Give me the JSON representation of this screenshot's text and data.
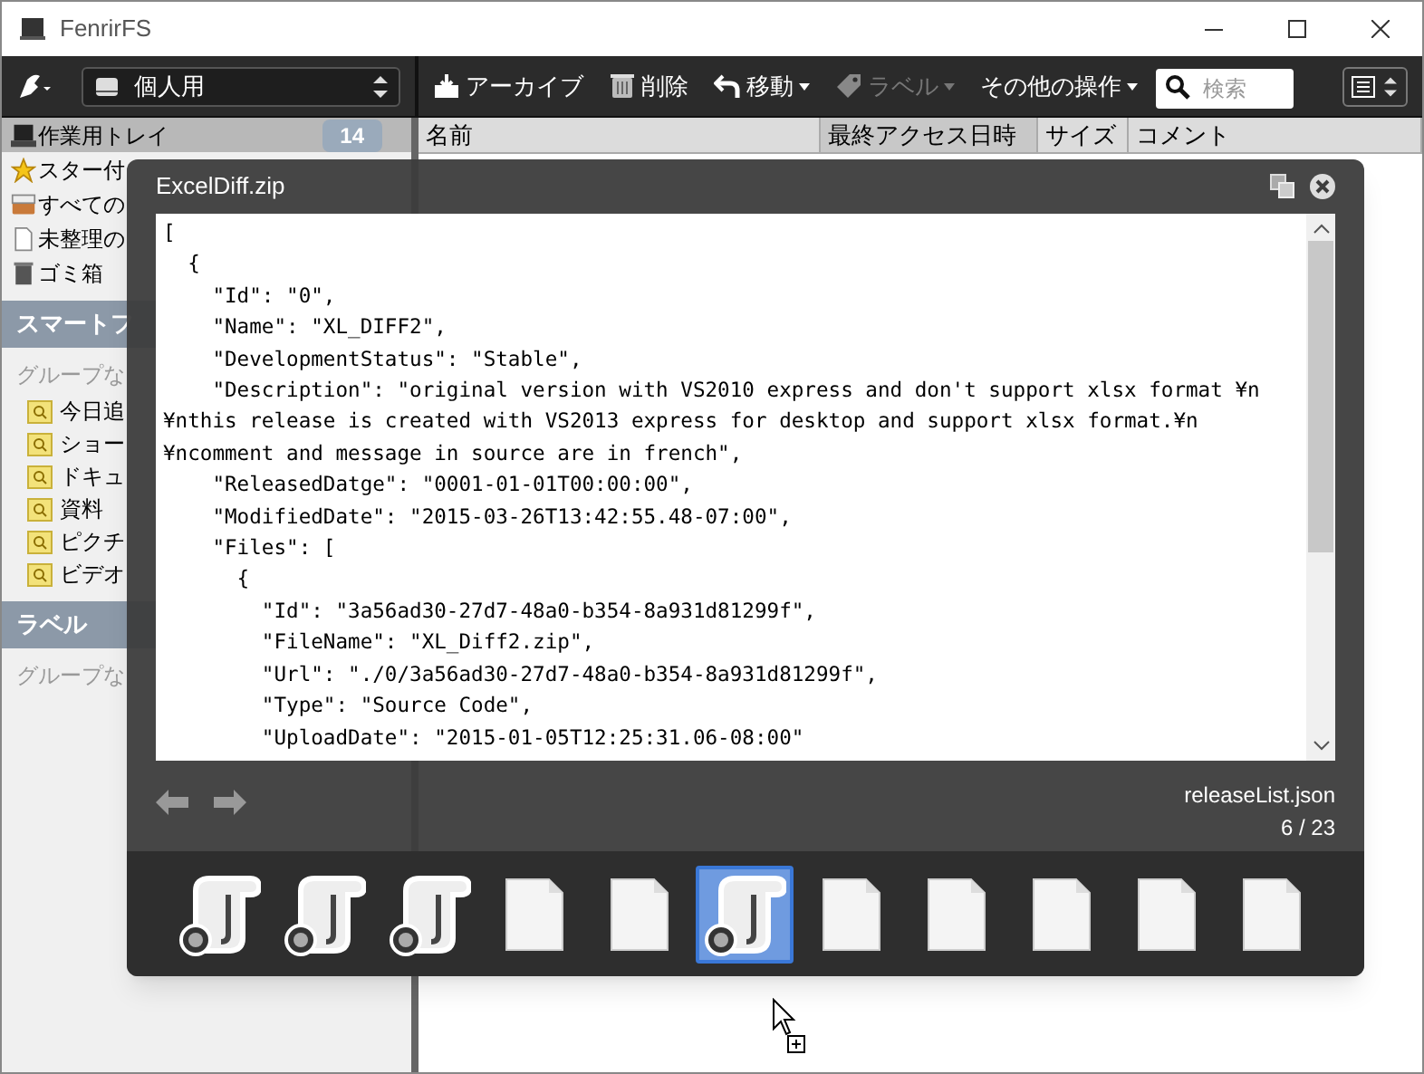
{
  "window": {
    "title": "FenrirFS"
  },
  "toolbar": {
    "profile": "個人用",
    "buttons": [
      {
        "kind": "archive",
        "label": "アーカイブ",
        "dropdown": false,
        "disabled": false
      },
      {
        "kind": "trash",
        "label": "削除",
        "dropdown": false,
        "disabled": false
      },
      {
        "kind": "move",
        "label": "移動",
        "dropdown": true,
        "disabled": false
      },
      {
        "kind": "label",
        "label": "ラベル",
        "dropdown": true,
        "disabled": true
      },
      {
        "kind": "none",
        "label": "その他の操作",
        "dropdown": true,
        "disabled": false
      }
    ],
    "search": {
      "placeholder": "検索"
    }
  },
  "sidebar": {
    "items": [
      {
        "kind": "tray",
        "label": "作業用トレイ",
        "count": "14",
        "selected": true
      },
      {
        "kind": "star",
        "label": "スター付",
        "selected": false
      },
      {
        "kind": "box",
        "label": "すべての",
        "selected": false
      },
      {
        "kind": "doc",
        "label": "未整理の",
        "selected": false
      },
      {
        "kind": "bin",
        "label": "ゴミ箱",
        "selected": false
      }
    ],
    "sections": [
      {
        "title": "スマートフ",
        "group": "グループな",
        "folders": [
          "今日追",
          "ショー",
          "ドキュ",
          "資料",
          "ピクチ",
          "ビデオ"
        ]
      },
      {
        "title": "ラベル",
        "group": "グループな"
      }
    ]
  },
  "table": {
    "columns": [
      "名前",
      "最終アクセス日時",
      "サイズ",
      "コメント"
    ]
  },
  "viewer": {
    "title": "ExcelDiff.zip",
    "code_lines": [
      "[",
      "  {",
      "    \"Id\": \"0\",",
      "    \"Name\": \"XL_DIFF2\",",
      "    \"DevelopmentStatus\": \"Stable\",",
      "    \"Description\": \"original version with VS2010 express and don't support xlsx format ¥n",
      "¥nthis release is created with VS2013 express for desktop and support xlsx format.¥n",
      "¥ncomment and message in source are in french\",",
      "    \"ReleasedDatge\": \"0001-01-01T00:00:00\",",
      "    \"ModifiedDate\": \"2015-03-26T13:42:55.48-07:00\",",
      "    \"Files\": [",
      "      {",
      "        \"Id\": \"3a56ad30-27d7-48a0-b354-8a931d81299f\",",
      "        \"FileName\": \"XL_Diff2.zip\",",
      "        \"Url\": \"./0/3a56ad30-27d7-48a0-b354-8a931d81299f\",",
      "        \"Type\": \"Source Code\",",
      "        \"UploadDate\": \"2015-01-05T12:25:31.06-08:00\""
    ],
    "file_name": "releaseList.json",
    "position": "6 / 23",
    "thumbnails": [
      {
        "kind": "script",
        "selected": false
      },
      {
        "kind": "script",
        "selected": false
      },
      {
        "kind": "script",
        "selected": false
      },
      {
        "kind": "blank",
        "selected": false
      },
      {
        "kind": "blank",
        "selected": false
      },
      {
        "kind": "script",
        "selected": true
      },
      {
        "kind": "blank",
        "selected": false
      },
      {
        "kind": "blank",
        "selected": false
      },
      {
        "kind": "blank",
        "selected": false
      },
      {
        "kind": "blank",
        "selected": false
      },
      {
        "kind": "blank",
        "selected": false
      }
    ]
  }
}
